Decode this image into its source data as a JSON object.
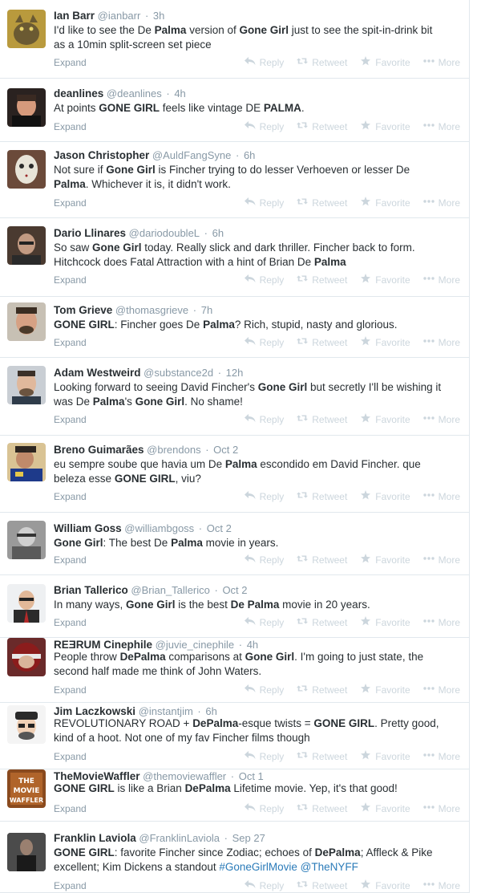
{
  "actions": {
    "expand": "Expand",
    "reply": "Reply",
    "retweet": "Retweet",
    "favorite": "Favorite",
    "more": "More"
  },
  "tweets": [
    {
      "name": "Ian Barr",
      "handle": "@ianbarr",
      "time": "3h",
      "segments": [
        [
          "I'd like to see the De ",
          false
        ],
        [
          "Palma",
          true
        ],
        [
          " version of ",
          false
        ],
        [
          "Gone Girl",
          true
        ],
        [
          " just to see the spit-in-drink bit as a 10min split-screen set piece",
          false
        ]
      ]
    },
    {
      "name": "deanlines",
      "handle": "@deanlines",
      "time": "4h",
      "segments": [
        [
          "At points ",
          false
        ],
        [
          "GONE GIRL",
          true
        ],
        [
          " feels like vintage DE ",
          false
        ],
        [
          "PALMA",
          true
        ],
        [
          ".",
          false
        ]
      ]
    },
    {
      "name": "Jason Christopher",
      "handle": "@AuldFangSyne",
      "time": "6h",
      "segments": [
        [
          "Not sure if ",
          false
        ],
        [
          "Gone Girl",
          true
        ],
        [
          " is Fincher trying to do lesser Verhoeven or lesser De ",
          false
        ],
        [
          "Palma",
          true
        ],
        [
          ". Whichever it is, it didn't work.",
          false
        ]
      ]
    },
    {
      "name": "Dario Llinares",
      "handle": "@dariodoubleL",
      "time": "6h",
      "segments": [
        [
          "So saw ",
          false
        ],
        [
          "Gone Girl",
          true
        ],
        [
          " today. Really slick and dark thriller. Fincher back to form. Hitchcock does Fatal Attraction with a hint of Brian De ",
          false
        ],
        [
          "Palma",
          true
        ]
      ]
    },
    {
      "name": "Tom Grieve",
      "handle": "@thomasgrieve",
      "time": "7h",
      "segments": [
        [
          "GONE GIRL",
          true
        ],
        [
          ": Fincher goes De ",
          false
        ],
        [
          "Palma",
          true
        ],
        [
          "? Rich, stupid, nasty and glorious.",
          false
        ]
      ]
    },
    {
      "name": "Adam Westweird",
      "handle": "@substance2d",
      "time": "12h",
      "segments": [
        [
          "Looking forward to seeing David Fincher's ",
          false
        ],
        [
          "Gone Girl",
          true
        ],
        [
          " but secretly I'll be wishing it was De ",
          false
        ],
        [
          "Palma",
          true
        ],
        [
          "'s ",
          false
        ],
        [
          "Gone Girl",
          true
        ],
        [
          ". No shame!",
          false
        ]
      ]
    },
    {
      "name": "Breno Guimarães",
      "handle": "@brendons",
      "time": "Oct 2",
      "segments": [
        [
          "eu sempre soube que havia um De ",
          false
        ],
        [
          "Palma",
          true
        ],
        [
          " escondido em David Fincher. que beleza esse ",
          false
        ],
        [
          "GONE GIRL",
          true
        ],
        [
          ", viu?",
          false
        ]
      ]
    },
    {
      "name": "William Goss",
      "handle": "@williambgoss",
      "time": "Oct 2",
      "segments": [
        [
          "Gone Girl",
          true
        ],
        [
          ": The best De ",
          false
        ],
        [
          "Palma",
          true
        ],
        [
          " movie in years.",
          false
        ]
      ]
    },
    {
      "name": "Brian Tallerico",
      "handle": "@Brian_Tallerico",
      "time": "Oct 2",
      "segments": [
        [
          "In many ways, ",
          false
        ],
        [
          "Gone Girl",
          true
        ],
        [
          " is the best ",
          false
        ],
        [
          "De Palma",
          true
        ],
        [
          " movie in 20 years.",
          false
        ]
      ]
    },
    {
      "name": "REƎRUM Cinephile",
      "handle": "@juvie_cinephile",
      "time": "4h",
      "segments": [
        [
          "People throw ",
          false
        ],
        [
          "DePalma",
          true
        ],
        [
          " comparisons at ",
          false
        ],
        [
          "Gone Girl",
          true
        ],
        [
          ". I'm going to just state, the second half made me think of John Waters.",
          false
        ]
      ]
    },
    {
      "name": "Jim Laczkowski",
      "handle": "@instantjim",
      "time": "6h",
      "segments": [
        [
          "REVOLUTIONARY ROAD + ",
          false
        ],
        [
          "DePalma",
          true
        ],
        [
          "-esque twists = ",
          false
        ],
        [
          "GONE GIRL",
          true
        ],
        [
          ". Pretty good, kind of a hoot. Not one of my fav Fincher films though",
          false
        ]
      ]
    },
    {
      "name": "TheMovieWaffler",
      "handle": "@themoviewaffler",
      "time": "Oct 1",
      "segments": [
        [
          "GONE GIRL",
          true
        ],
        [
          " is like a Brian ",
          false
        ],
        [
          "DePalma",
          true
        ],
        [
          " Lifetime movie. Yep, it's that good!",
          false
        ]
      ]
    },
    {
      "name": "Franklin Laviola",
      "handle": "@FranklinLaviola",
      "time": "Sep 27",
      "segments": [
        [
          "GONE GIRL",
          true
        ],
        [
          ": favorite Fincher since Zodiac; echoes of ",
          false
        ],
        [
          "DePalma",
          true
        ],
        [
          "; Affleck & Pike excellent; Kim Dickens a standout ",
          false
        ],
        [
          "#GoneGirlMovie @TheNYFF",
          "link"
        ]
      ]
    }
  ]
}
